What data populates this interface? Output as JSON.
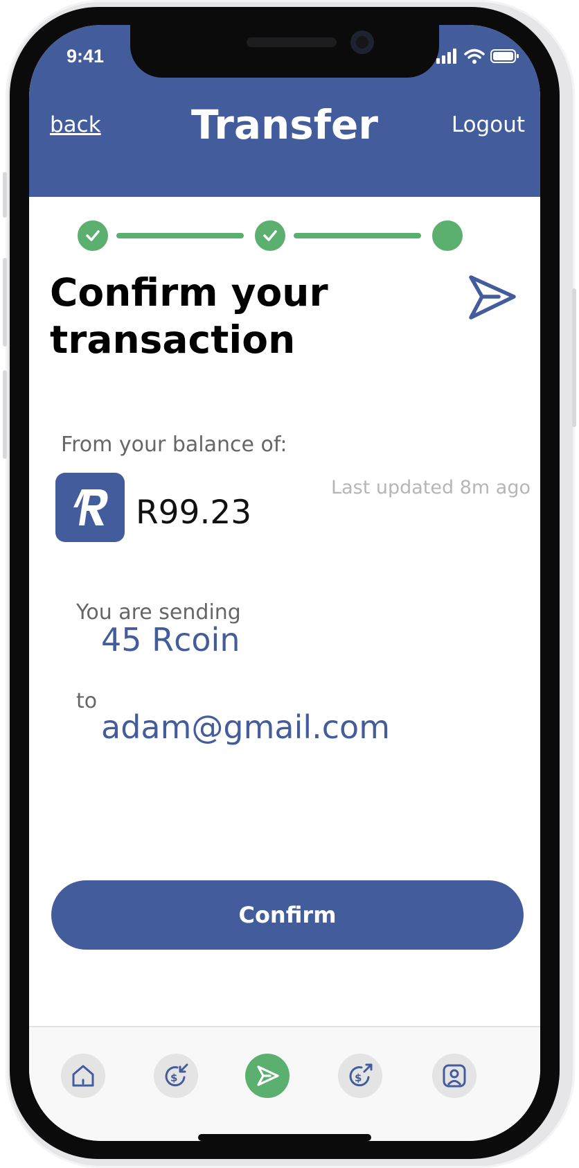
{
  "status_bar": {
    "time": "9:41"
  },
  "header": {
    "back": "back",
    "title": "Transfer",
    "logout": "Logout"
  },
  "stepper": {
    "steps_total": 3,
    "completed": 2,
    "current": 3
  },
  "main": {
    "heading": "Confirm your transaction",
    "from_label": "From your balance of:",
    "balance": "R99.23",
    "last_updated": "Last updated 8m ago",
    "sending_label": "You are sending",
    "amount": "45 Rcoin",
    "to_label": "to",
    "recipient": "adam@gmail.com",
    "confirm_label": "Confirm"
  },
  "tabbar": {
    "items": [
      "home-icon",
      "receive-money-icon",
      "send-icon",
      "send-money-icon",
      "profile-icon"
    ],
    "active": "send-icon"
  },
  "colors": {
    "primary": "#435c9b",
    "success": "#5bb06f",
    "muted_text": "#666666",
    "faint_text": "#b6b6b6"
  }
}
